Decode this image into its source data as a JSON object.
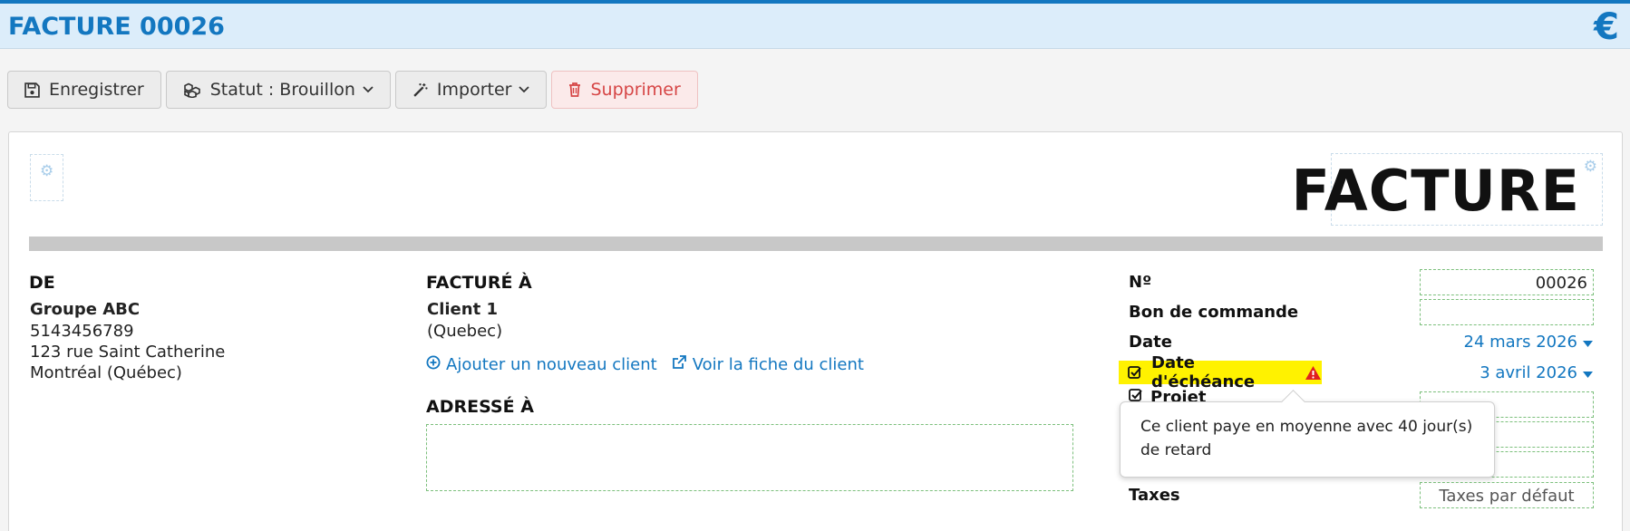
{
  "header": {
    "title": "FACTURE 00026",
    "currency_symbol": "€"
  },
  "toolbar": {
    "save_label": "Enregistrer",
    "status_label": "Statut : Brouillon",
    "import_label": "Importer",
    "delete_label": "Supprimer"
  },
  "document": {
    "title": "FACTURE",
    "from": {
      "heading": "DE",
      "name": "Groupe ABC",
      "phone": "5143456789",
      "street": "123 rue Saint Catherine",
      "city": "Montréal (Québec)"
    },
    "billed_to": {
      "heading": "FACTURÉ À",
      "name": "Client 1",
      "region": "(Quebec)",
      "add_client_link": "Ajouter un nouveau client",
      "view_client_link": "Voir la fiche du client"
    },
    "ship_to": {
      "heading": "ADRESSÉ À",
      "value": ""
    },
    "meta": {
      "number_label": "Nº",
      "number_value": "00026",
      "po_label": "Bon de commande",
      "po_value": "",
      "date_label": "Date",
      "date_value": "24 mars 2026",
      "due_label": "Date d'échéance",
      "due_value": "3 avril 2026",
      "project_label": "Projet",
      "taxes_label": "Taxes",
      "taxes_value": "Taxes par défaut"
    },
    "tooltip": "Ce client paye en moyenne avec 40 jour(s) de retard"
  },
  "colors": {
    "accent": "#1377c0",
    "highlight": "#fff200",
    "danger": "#d64545",
    "warning": "#e02020"
  }
}
